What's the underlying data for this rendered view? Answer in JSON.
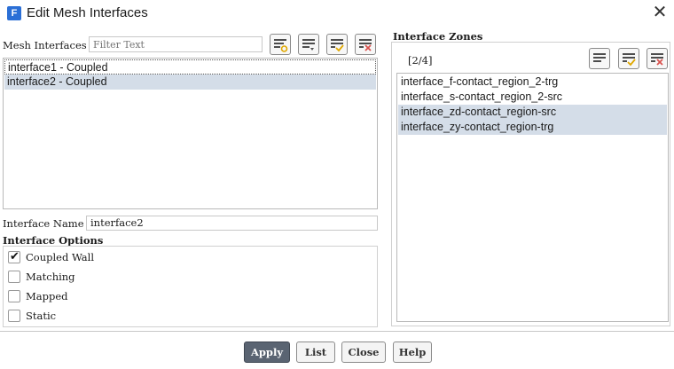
{
  "window": {
    "title": "Edit Mesh Interfaces",
    "app_icon": "F"
  },
  "mesh_interfaces": {
    "label": "Mesh Interfaces",
    "filter_placeholder": "Filter Text",
    "items": [
      {
        "label": "interface1 - Coupled",
        "selected": false
      },
      {
        "label": "interface2 - Coupled",
        "selected": true
      }
    ]
  },
  "interface_name": {
    "label": "Interface Name",
    "value": "interface2"
  },
  "interface_options": {
    "label": "Interface Options",
    "options": [
      {
        "label": "Coupled Wall",
        "checked": true
      },
      {
        "label": "Matching",
        "checked": false
      },
      {
        "label": "Mapped",
        "checked": false
      },
      {
        "label": "Static",
        "checked": false
      }
    ]
  },
  "interface_zones": {
    "label": "Interface Zones",
    "count": "[2/4]",
    "items": [
      {
        "label": "interface_f-contact_region_2-trg",
        "selected": false
      },
      {
        "label": "interface_s-contact_region_2-src",
        "selected": false
      },
      {
        "label": "interface_zd-contact_region-src",
        "selected": true
      },
      {
        "label": "interface_zy-contact_region-trg",
        "selected": true
      }
    ]
  },
  "buttons": {
    "apply": "Apply",
    "list": "List",
    "close": "Close",
    "help": "Help"
  },
  "colors": {
    "selection": "#d4dde8",
    "primary_button": "#5a6472",
    "check_accent": "#e0a800",
    "clear_accent": "#d9534f"
  }
}
